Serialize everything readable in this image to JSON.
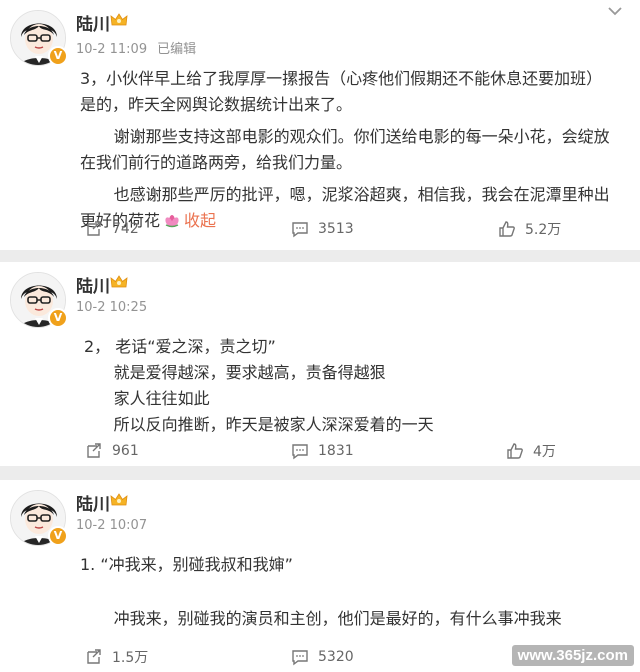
{
  "posts": [
    {
      "author": "陆川",
      "time": "10-2 11:09",
      "edited": "已编辑",
      "paragraphs": [
        "3，小伙伴早上给了我厚厚一摞报告（心疼他们假期还不能休息还要加班）是的，昨天全网舆论数据统计出来了。",
        "谢谢那些支持这部电影的观众们。你们送给电影的每一朵小花，会绽放在我们前行的道路两旁，给我们力量。",
        "也感谢那些严厉的批评，嗯，泥浆浴超爽，相信我，我会在泥潭里种出更好的荷花"
      ],
      "collapse": "收起",
      "reposts": "742",
      "comments": "3513",
      "likes": "5.2万"
    },
    {
      "author": "陆川",
      "time": "10-2 10:25",
      "paragraphs": [
        "2， 老话“爱之深，责之切”",
        "就是爱得越深，要求越高，责备得越狠",
        "家人往往如此",
        "所以反向推断，昨天是被家人深深爱着的一天"
      ],
      "reposts": "961",
      "comments": "1831",
      "likes": "4万"
    },
    {
      "author": "陆川",
      "time": "10-2 10:07",
      "paragraphs": [
        "1. “冲我来，别碰我叔和我婶”",
        "冲我来，别碰我的演员和主创，他们是最好的，有什么事冲我来"
      ],
      "reposts": "1.5万",
      "comments": "5320",
      "likes": ""
    }
  ],
  "watermark": "www.365jz.com",
  "colors": {
    "collapse": "#eb7350",
    "meta": "#939393",
    "badge": "#f0a11b"
  }
}
